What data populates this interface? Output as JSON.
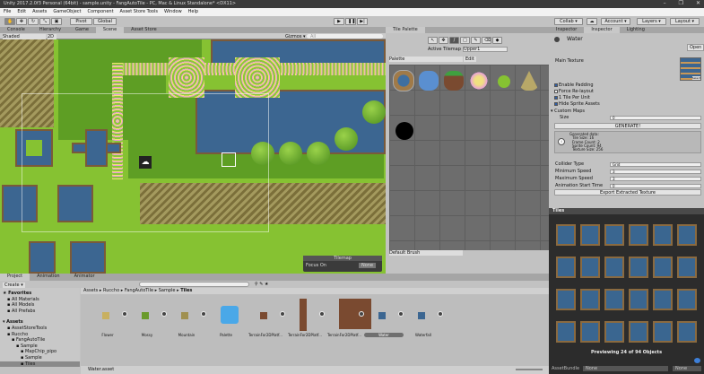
{
  "window": {
    "title": "Unity 2017.2.0f3 Personal (64bit) - sample.unity - FangAutoTile - PC, Mac & Linux Standalone* <DX11>",
    "controls": [
      "–",
      "❐",
      "✕"
    ]
  },
  "menu": [
    "File",
    "Edit",
    "Assets",
    "GameObject",
    "Component",
    "Asset Store Tools",
    "Window",
    "Help"
  ],
  "toolbar": {
    "pivot": "Pivot",
    "global": "Global",
    "collab": "Collab ▾",
    "account": "Account ▾",
    "layers": "Layers ▾",
    "layout": "Layout ▾",
    "play": "▶",
    "pause": "❚❚",
    "step": "▶|"
  },
  "left_tabs": [
    "Console",
    "Hierarchy",
    "Game",
    "Scene",
    "Asset Store"
  ],
  "scene_bar": {
    "shading": "Shaded",
    "mode": "2D",
    "gizmos": "Gizmos ▾",
    "search_placeholder": "All"
  },
  "tilemap_overlay": {
    "title": "Tilemap",
    "focus_label": "Focus On",
    "focus_value": "None"
  },
  "palette": {
    "tab": "Tile Palette",
    "active_tilemap_label": "Active Tilemap",
    "active_tilemap_value": "Upper1",
    "palette_value": "Palette",
    "edit": "Edit",
    "brush": "Default Brush"
  },
  "inspector": {
    "tabs": [
      "Inspector",
      "Inspector",
      "Lighting"
    ],
    "object": "Water",
    "open": "Open",
    "main_texture": "Main Texture",
    "select": "Select",
    "checks": [
      {
        "label": "Enable Padding",
        "on": true
      },
      {
        "label": "Force Re-layout",
        "on": false
      },
      {
        "label": "1 Tile Per Unit",
        "on": true
      },
      {
        "label": "Hide Sprite Assets",
        "on": true
      }
    ],
    "custom_maps": "Custom Maps",
    "size_label": "Size",
    "size_value": "0",
    "generate": "GENERATE!",
    "info": [
      "Generated data:",
      "Tile Size: 16",
      "Frame Count: 2",
      "Sprite Count: 94",
      "Texture Size: 256"
    ],
    "collider_label": "Collider Type",
    "collider_value": "Grid",
    "min_speed_label": "Minimum Speed",
    "min_speed": "3",
    "max_speed_label": "Maximum Speed",
    "max_speed": "3",
    "anim_start_label": "Animation Start Time",
    "anim_start": "0",
    "export": "Export Extracted Texture"
  },
  "tiles_preview": {
    "title": "Tiles",
    "caption": "Previewing 24 of 94 Objects",
    "assetbundle": "AssetBundle",
    "none1": "None",
    "none2": "None"
  },
  "project": {
    "tabs": [
      "Project",
      "Animation",
      "Animator"
    ],
    "create": "Create ▾",
    "tree": [
      {
        "label": "Favorites",
        "depth": 0
      },
      {
        "label": "All Materials",
        "depth": 1
      },
      {
        "label": "All Models",
        "depth": 1
      },
      {
        "label": "All Prefabs",
        "depth": 1
      },
      {
        "label": "Assets",
        "depth": 0
      },
      {
        "label": "AssetStoreTools",
        "depth": 1
      },
      {
        "label": "Rucchо",
        "depth": 1
      },
      {
        "label": "FangAutoTile",
        "depth": 2
      },
      {
        "label": "Sample",
        "depth": 3
      },
      {
        "label": "MapChip_pipo",
        "depth": 4
      },
      {
        "label": "Sample",
        "depth": 4
      },
      {
        "label": "Tiles",
        "depth": 4
      }
    ],
    "breadcrumb": [
      "Assets",
      "Rucchо",
      "FangAutoTile",
      "Sample",
      "Tiles"
    ],
    "assets": [
      "Flower",
      "Mossy",
      "Mountain",
      "Palette",
      "TerrainFor2DPlatf...",
      "TerrainFor2DPlatf...",
      "TerrainFor2DPlatf...",
      "Water",
      "Waterfall"
    ],
    "selected": "Water.asset"
  }
}
